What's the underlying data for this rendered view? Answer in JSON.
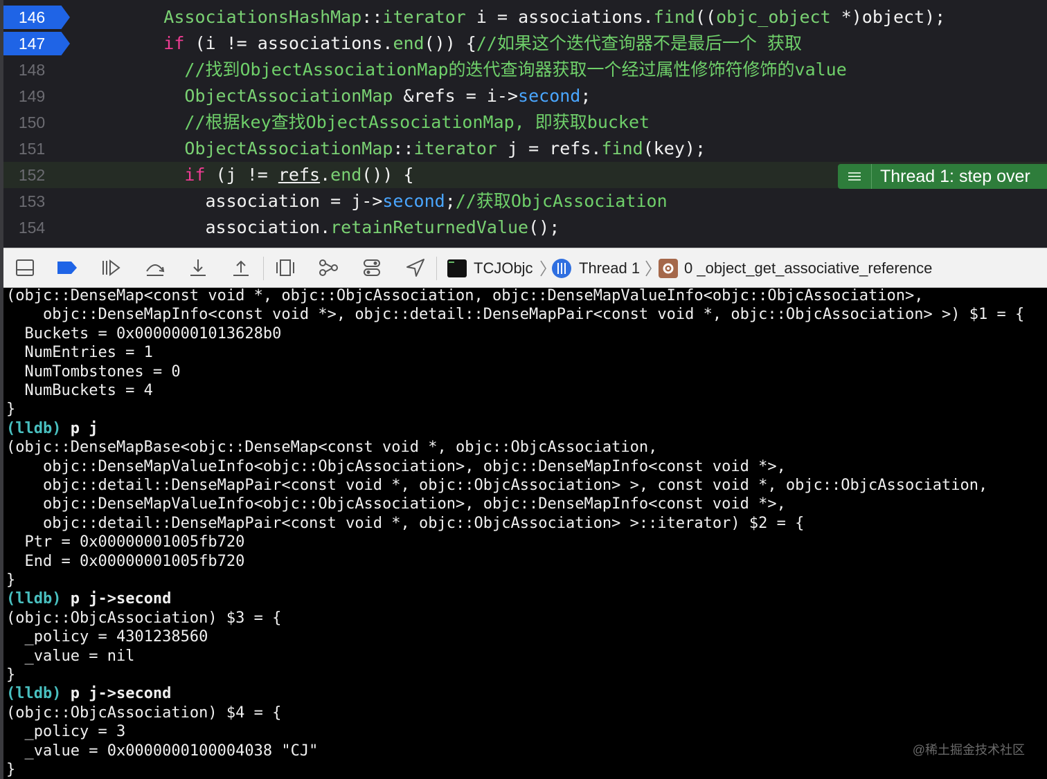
{
  "editor": {
    "lines": [
      {
        "num": "146",
        "breakpoint": true,
        "indent": 6,
        "tokens": [
          {
            "t": "ty",
            "v": "AssociationsHashMap"
          },
          {
            "t": "",
            "v": "::"
          },
          {
            "t": "ty",
            "v": "iterator"
          },
          {
            "t": "",
            "v": " i = associations."
          },
          {
            "t": "fn",
            "v": "find"
          },
          {
            "t": "",
            "v": "(("
          },
          {
            "t": "ty",
            "v": "objc_object"
          },
          {
            "t": "",
            "v": " *)object);"
          }
        ]
      },
      {
        "num": "147",
        "breakpoint": true,
        "indent": 6,
        "tokens": [
          {
            "t": "kw",
            "v": "if"
          },
          {
            "t": "",
            "v": " (i != associations."
          },
          {
            "t": "fn",
            "v": "end"
          },
          {
            "t": "",
            "v": "()) {"
          },
          {
            "t": "cm",
            "v": "//如果这个迭代查询器不是最后一个 获取"
          }
        ]
      },
      {
        "num": "148",
        "breakpoint": false,
        "indent": 8,
        "tokens": [
          {
            "t": "cm",
            "v": "//找到ObjectAssociationMap的迭代查询器获取一个经过属性修饰符修饰的value"
          }
        ]
      },
      {
        "num": "149",
        "breakpoint": false,
        "indent": 8,
        "tokens": [
          {
            "t": "ty",
            "v": "ObjectAssociationMap"
          },
          {
            "t": "",
            "v": " &refs = i->"
          },
          {
            "t": "mem",
            "v": "second"
          },
          {
            "t": "",
            "v": ";"
          }
        ]
      },
      {
        "num": "150",
        "breakpoint": false,
        "indent": 8,
        "tokens": [
          {
            "t": "cm",
            "v": "//根据key查找ObjectAssociationMap, 即获取bucket"
          }
        ]
      },
      {
        "num": "151",
        "breakpoint": false,
        "indent": 8,
        "tokens": [
          {
            "t": "ty",
            "v": "ObjectAssociationMap"
          },
          {
            "t": "",
            "v": "::"
          },
          {
            "t": "ty",
            "v": "iterator"
          },
          {
            "t": "",
            "v": " j = refs."
          },
          {
            "t": "fn",
            "v": "find"
          },
          {
            "t": "",
            "v": "(key);"
          }
        ]
      },
      {
        "num": "152",
        "breakpoint": false,
        "current": true,
        "indent": 8,
        "tokens": [
          {
            "t": "kw",
            "v": "if"
          },
          {
            "t": "",
            "v": " (j != "
          },
          {
            "t": "u",
            "v": "refs"
          },
          {
            "t": "",
            "v": "."
          },
          {
            "t": "fn",
            "v": "end"
          },
          {
            "t": "",
            "v": "()) {"
          }
        ]
      },
      {
        "num": "153",
        "breakpoint": false,
        "indent": 10,
        "tokens": [
          {
            "t": "",
            "v": "association = j->"
          },
          {
            "t": "mem",
            "v": "second"
          },
          {
            "t": "",
            "v": ";"
          },
          {
            "t": "cm",
            "v": "//获取ObjcAssociation"
          }
        ]
      },
      {
        "num": "154",
        "breakpoint": false,
        "indent": 10,
        "tokens": [
          {
            "t": "",
            "v": "association."
          },
          {
            "t": "fn",
            "v": "retainReturnedValue"
          },
          {
            "t": "",
            "v": "();"
          }
        ]
      }
    ],
    "thread_badge": "Thread 1: step over"
  },
  "toolbar": {
    "icons": [
      "hide-console-icon",
      "breakpoints-toggle-icon",
      "continue-icon",
      "step-over-icon",
      "step-into-icon",
      "step-out-icon",
      "view-hierarchy-icon",
      "memory-graph-icon",
      "environment-overrides-icon",
      "simulate-location-icon"
    ],
    "breadcrumb": {
      "target": "TCJObjc",
      "thread": "Thread 1",
      "frame": "0 _object_get_associative_reference"
    }
  },
  "console": {
    "lines": [
      {
        "text": "(objc::DenseMap<const void *, objc::ObjcAssociation, objc::DenseMapValueInfo<objc::ObjcAssociation>,"
      },
      {
        "text": "    objc::DenseMapInfo<const void *>, objc::detail::DenseMapPair<const void *, objc::ObjcAssociation> >) $1 = {"
      },
      {
        "text": "  Buckets = 0x00000001013628b0"
      },
      {
        "text": "  NumEntries = 1"
      },
      {
        "text": "  NumTombstones = 0"
      },
      {
        "text": "  NumBuckets = 4"
      },
      {
        "text": "}"
      },
      {
        "prompt": "(lldb)",
        "cmd": " p j"
      },
      {
        "text": "(objc::DenseMapBase<objc::DenseMap<const void *, objc::ObjcAssociation,"
      },
      {
        "text": "    objc::DenseMapValueInfo<objc::ObjcAssociation>, objc::DenseMapInfo<const void *>,"
      },
      {
        "text": "    objc::detail::DenseMapPair<const void *, objc::ObjcAssociation> >, const void *, objc::ObjcAssociation,"
      },
      {
        "text": "    objc::DenseMapValueInfo<objc::ObjcAssociation>, objc::DenseMapInfo<const void *>,"
      },
      {
        "text": "    objc::detail::DenseMapPair<const void *, objc::ObjcAssociation> >::iterator) $2 = {"
      },
      {
        "text": "  Ptr = 0x00000001005fb720"
      },
      {
        "text": "  End = 0x00000001005fb720"
      },
      {
        "text": "}"
      },
      {
        "prompt": "(lldb)",
        "cmd": " p j->second"
      },
      {
        "text": "(objc::ObjcAssociation) $3 = {"
      },
      {
        "text": "  _policy = 4301238560"
      },
      {
        "text": "  _value = nil"
      },
      {
        "text": "}"
      },
      {
        "prompt": "(lldb)",
        "cmd": " p j->second"
      },
      {
        "text": "(objc::ObjcAssociation) $4 = {"
      },
      {
        "text": "  _policy = 3"
      },
      {
        "text": "  _value = 0x0000000100004038 \"CJ\""
      },
      {
        "text": "}"
      }
    ]
  },
  "watermark": "@稀土掘金技术社区",
  "colors": {
    "breakpoint": "#1f64e6",
    "keyword": "#ee3c93",
    "type": "#7ad173",
    "member": "#4aa6ff",
    "lldb_prompt": "#49c0c0",
    "thread_badge": "#2e7d3b"
  }
}
